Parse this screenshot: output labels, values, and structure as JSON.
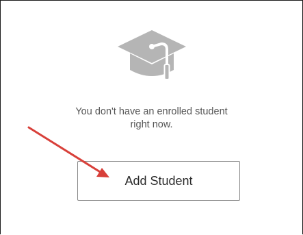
{
  "empty_state": {
    "icon": "graduation-cap-icon",
    "icon_color": "#b5b5b5",
    "message_line1": "You don't have an enrolled student",
    "message_line2": "right now."
  },
  "actions": {
    "add_student_label": "Add Student"
  },
  "annotation": {
    "arrow_color": "#d8403a"
  }
}
